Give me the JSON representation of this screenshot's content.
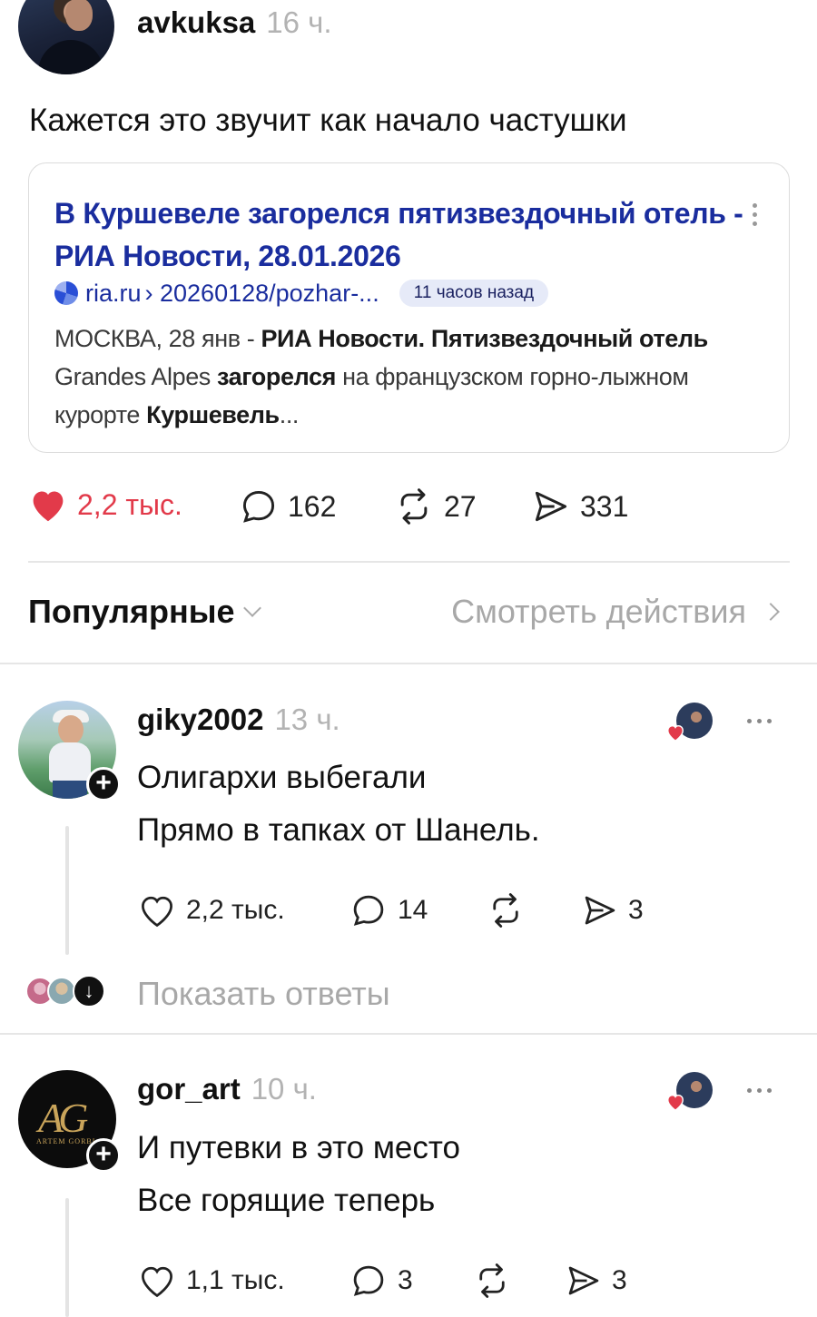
{
  "post": {
    "username": "avkuksa",
    "time": "16 ч.",
    "text": "Кажется это звучит как начало частушки",
    "link_card": {
      "title": "В Куршевеле загорелся пятизвездочный отель - РИА Новости, 28.01.2026",
      "domain": "ria.ru",
      "path": "› 20260128/pozhar-...",
      "badge": "11 часов назад",
      "snippet_1": "МОСКВА, 28 янв - ",
      "snippet_2": "РИА Новости. Пятизвездочный отель",
      "snippet_3": " Grandes Alpes ",
      "snippet_4": "загорелся",
      "snippet_5": " на французском горно-лыжном курорте ",
      "snippet_6": "Куршевель",
      "snippet_7": "..."
    },
    "actions": {
      "likes": "2,2 тыс.",
      "comments": "162",
      "reposts": "27",
      "shares": "331"
    }
  },
  "tabs": {
    "sort_label": "Популярные",
    "view_actions": "Смотреть действия"
  },
  "comments": [
    {
      "username": "giky2002",
      "time": "13 ч.",
      "line1": "Олигархи выбегали",
      "line2": "Прямо в тапках от Шанель.",
      "likes": "2,2 тыс.",
      "comments": "14",
      "shares": "3",
      "show_replies": "Показать ответы"
    },
    {
      "username": "gor_art",
      "time": "10 ч.",
      "line1": "И путевки в это место",
      "line2": "Все горящие теперь",
      "likes": "1,1 тыс.",
      "comments": "3",
      "shares": "3",
      "avatar_monogram": "AG",
      "avatar_caption": "ARTEM GORBL"
    }
  ],
  "colors": {
    "like_red": "#e23a4a",
    "link_blue": "#1a2d9e",
    "muted": "#b3b3b3"
  }
}
